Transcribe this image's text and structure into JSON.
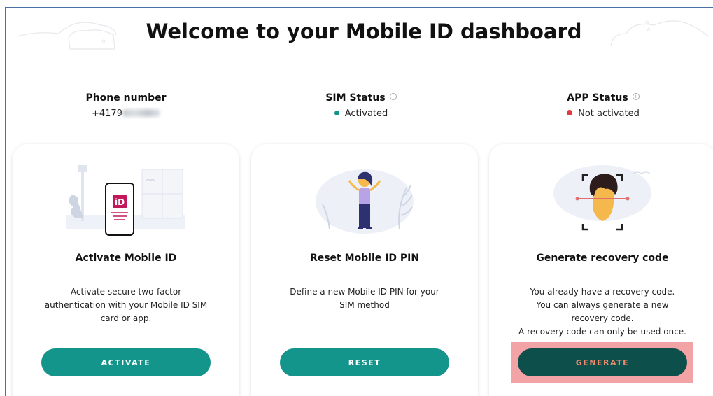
{
  "header": {
    "title": "Welcome to your Mobile ID dashboard"
  },
  "status": {
    "phone": {
      "label": "Phone number",
      "value": "+4179"
    },
    "sim": {
      "label": "SIM Status",
      "value": "Activated",
      "dot_color": "#13958b"
    },
    "app": {
      "label": "APP Status",
      "value": "Not activated",
      "dot_color": "#e03a44"
    }
  },
  "cards": [
    {
      "title": "Activate Mobile ID",
      "description": [
        "Activate secure two-factor",
        "authentication with your Mobile ID SIM",
        "card or app."
      ],
      "button": "ACTIVATE"
    },
    {
      "title": "Reset Mobile ID PIN",
      "description": [
        "Define a new Mobile ID PIN for your",
        "SIM method"
      ],
      "button": "RESET"
    },
    {
      "title": "Generate recovery code",
      "description": [
        "You already have a recovery code.",
        "You can always generate a new",
        "recovery code.",
        "A recovery code can only be used once."
      ],
      "button": "GENERATE"
    }
  ],
  "colors": {
    "accent": "#13958b",
    "accent_dark": "#0d4f4b",
    "highlight": "#f2a3a6"
  },
  "icons": {
    "info": "info-icon",
    "illustrations": [
      "phone-illustration",
      "person-illustration",
      "face-scan-illustration"
    ]
  }
}
